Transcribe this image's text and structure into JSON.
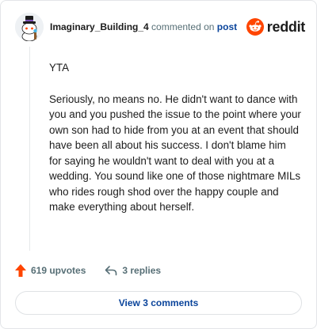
{
  "header": {
    "username": "Imaginary_Building_4",
    "commented_text": "commented on",
    "post_link": "post",
    "brand": "reddit",
    "brand_color": "#ff4500"
  },
  "comment": {
    "paragraphs": [
      "YTA",
      "Seriously, no means no. He didn't want to dance with you and you pushed the issue to the point where your own son had to hide from you at an event that should have been all about his success. I don't blame him for saying he wouldn't want to deal with you at a wedding. You sound like one of those nightmare MILs who rides rough shod over the happy couple and make everything about herself."
    ]
  },
  "actions": {
    "upvotes": "619 upvotes",
    "upvote_icon": "upvote-arrow-icon",
    "upvote_color": "#ff4500",
    "replies": "3 replies",
    "reply_icon": "reply-arrow-icon"
  },
  "footer": {
    "view_comments": "View 3 comments"
  }
}
